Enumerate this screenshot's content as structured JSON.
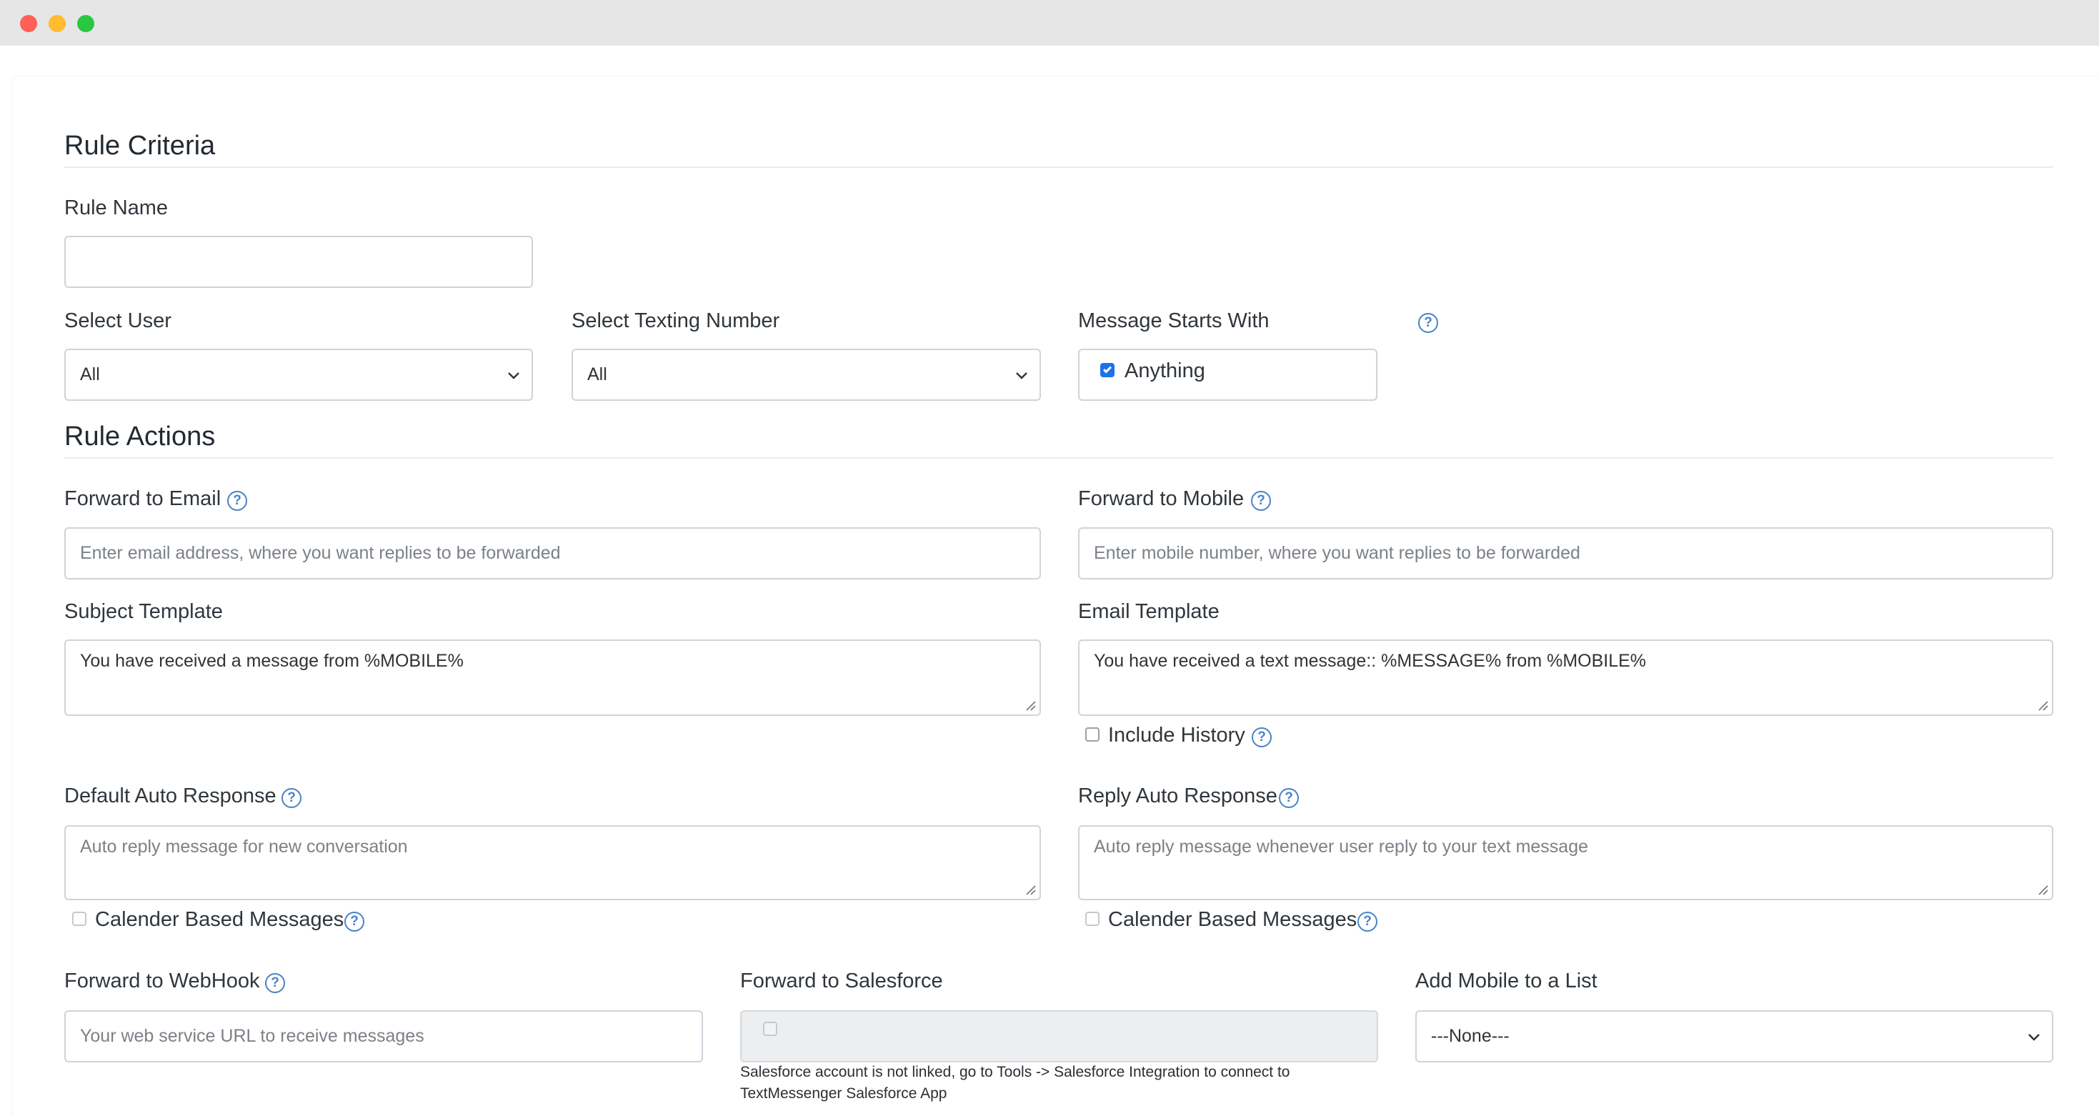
{
  "window": {
    "controls": [
      "close",
      "minimize",
      "zoom"
    ]
  },
  "rule_criteria": {
    "title": "Rule Criteria",
    "rule_name": {
      "label": "Rule Name",
      "value": ""
    },
    "select_user": {
      "label": "Select User",
      "value": "All"
    },
    "select_texting_number": {
      "label": "Select Texting Number",
      "value": "All"
    },
    "message_starts_with": {
      "label": "Message Starts With",
      "option_label": "Anything",
      "checked": true
    }
  },
  "rule_actions": {
    "title": "Rule Actions",
    "forward_to_email": {
      "label": "Forward to Email",
      "placeholder": "Enter email address, where you want replies to be forwarded"
    },
    "forward_to_mobile": {
      "label": "Forward to Mobile",
      "placeholder": "Enter mobile number, where you want replies to be forwarded"
    },
    "subject_template": {
      "label": "Subject Template",
      "value": "You have received a message from %MOBILE%"
    },
    "email_template": {
      "label": "Email Template",
      "value": "You have received a text message:: %MESSAGE% from %MOBILE%"
    },
    "include_history": {
      "label": "Include History",
      "checked": false
    },
    "default_auto_response": {
      "label": "Default Auto Response",
      "placeholder": "Auto reply message for new conversation",
      "calendar_label": "Calender Based Messages",
      "calendar_checked": false
    },
    "reply_auto_response": {
      "label": "Reply Auto Response",
      "placeholder": "Auto reply message whenever user reply to your text message",
      "calendar_label": "Calender Based Messages",
      "calendar_checked": false
    },
    "forward_to_webhook": {
      "label": "Forward to WebHook",
      "placeholder": "Your web service URL to receive messages"
    },
    "forward_to_salesforce": {
      "label": "Forward to Salesforce",
      "note_line1": "Salesforce account is not linked, go to Tools -> Salesforce Integration to connect to",
      "note_line2": "TextMessenger Salesforce App"
    },
    "add_mobile_to_list": {
      "label": "Add Mobile to a List",
      "value": "---None---"
    }
  },
  "icons": {
    "help": "question-circle-icon",
    "select": "chevron-down-icon",
    "resize": "resize-grip-icon"
  },
  "colors": {
    "accent": "#1a73e8",
    "help_icon": "#4a83c6",
    "window_close": "#fe5f57",
    "window_minimize": "#febc2e",
    "window_zoom": "#28c840"
  }
}
